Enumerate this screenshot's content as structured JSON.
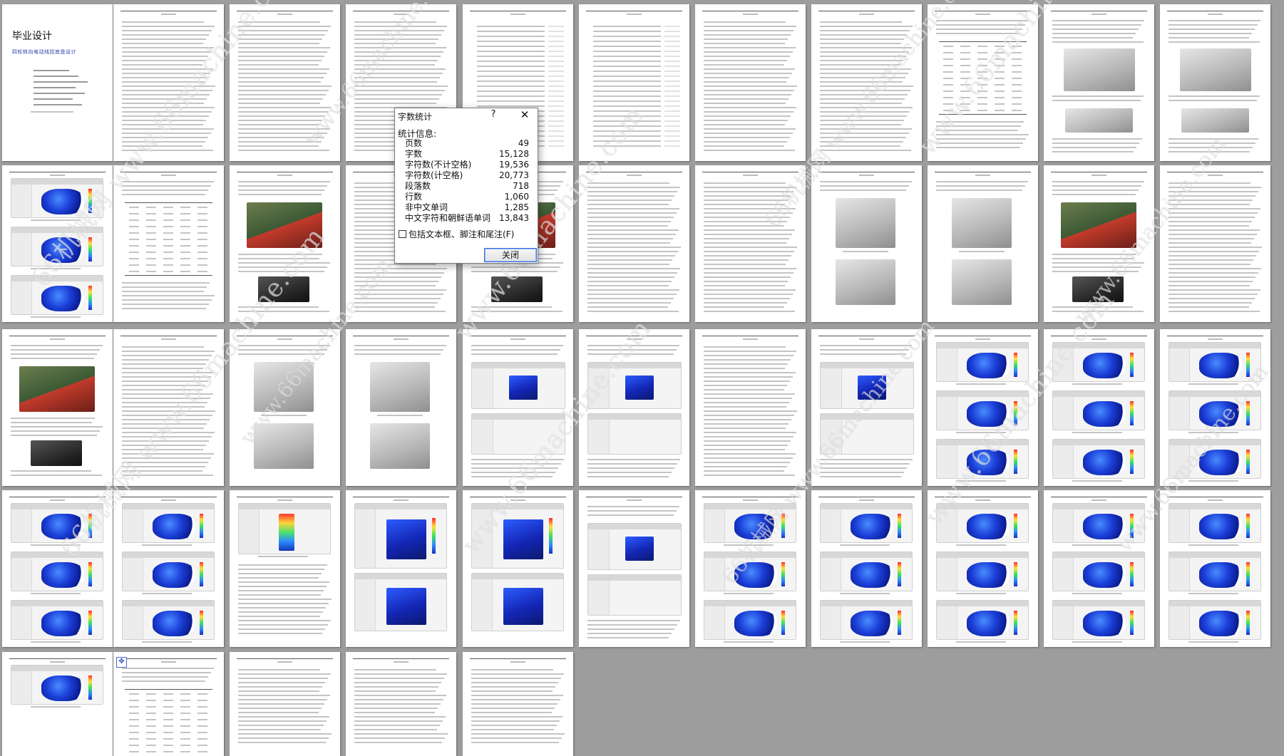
{
  "document": {
    "cover_title": "毕业设计",
    "cover_subtitle": "四轮转向电动线控底盘设计"
  },
  "watermark": {
    "text_url": "www.66machine.com",
    "text_cn": "66机械网"
  },
  "word_count_dialog": {
    "title": "字数统计",
    "help_label": "?",
    "close_glyph": "✕",
    "section_label": "统计信息:",
    "stats": [
      {
        "label": "页数",
        "value": "49"
      },
      {
        "label": "字数",
        "value": "15,128"
      },
      {
        "label": "字符数(不计空格)",
        "value": "19,536"
      },
      {
        "label": "字符数(计空格)",
        "value": "20,773"
      },
      {
        "label": "段落数",
        "value": "718"
      },
      {
        "label": "行数",
        "value": "1,060"
      },
      {
        "label": "非中文单词",
        "value": "1,285"
      },
      {
        "label": "中文字符和朝鲜语单词",
        "value": "13,843"
      }
    ],
    "checkbox_label": "包括文本框、脚注和尾注(F)",
    "close_button_label": "关闭"
  }
}
